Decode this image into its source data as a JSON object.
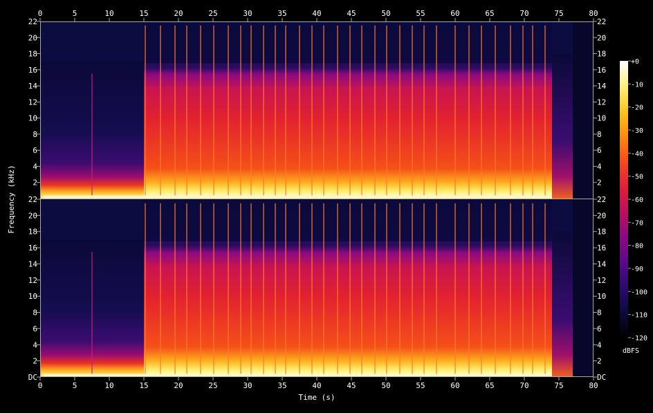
{
  "chart_data": {
    "type": "heatmap",
    "title": "",
    "xlabel": "Time (s)",
    "ylabel": "Frequency (kHz)",
    "xlim": [
      0,
      80
    ],
    "ylim_khz": [
      0,
      22
    ],
    "x_ticks": [
      0,
      5,
      10,
      15,
      20,
      25,
      30,
      35,
      40,
      45,
      50,
      55,
      60,
      65,
      70,
      75,
      80
    ],
    "x_tick_labels": [
      "0",
      "5",
      "10",
      "15",
      "20",
      "25",
      "30",
      "35",
      "40",
      "45",
      "50",
      "55",
      "60",
      "65",
      "70",
      "75",
      "80"
    ],
    "y_ticks": [
      0,
      2,
      4,
      6,
      8,
      10,
      12,
      14,
      16,
      18,
      20,
      22
    ],
    "y_tick_labels": [
      "DC",
      "2",
      "4",
      "6",
      "8",
      "10",
      "12",
      "14",
      "16",
      "18",
      "20",
      "22"
    ],
    "channels": 2,
    "colorbar": {
      "label": "dBFS",
      "range": [
        -120,
        0
      ],
      "ticks": [
        0,
        -10,
        -20,
        -30,
        -40,
        -50,
        -60,
        -70,
        -80,
        -90,
        -100,
        -110,
        -120
      ],
      "tick_labels": [
        "+0",
        "-10",
        "-20",
        "-30",
        "-40",
        "-50",
        "-60",
        "-70",
        "-80",
        "-90",
        "-100",
        "-110",
        "-120"
      ],
      "colors": [
        "#000000",
        "#0b0b3d",
        "#2a0b6e",
        "#5a0a8a",
        "#8a0a80",
        "#bb1060",
        "#e0203a",
        "#f54a20",
        "#fb8a10",
        "#fdc520",
        "#fff080",
        "#ffffff"
      ]
    },
    "segments": [
      {
        "start": 0,
        "end": 15,
        "level": "quiet intro, energy mostly below 4 kHz"
      },
      {
        "start": 15,
        "end": 74,
        "level": "loud, energy up to ~16.5 kHz"
      },
      {
        "start": 74,
        "end": 77,
        "level": "fade-out"
      }
    ],
    "transients_s": [
      7.5,
      15.2,
      17.4,
      19.5,
      21.2,
      23.2,
      25.1,
      27.2,
      29.0,
      30.5,
      32.3,
      34.0,
      35.5,
      37.5,
      39.3,
      41.0,
      43.0,
      44.8,
      46.5,
      48.4,
      50.1,
      52.0,
      53.8,
      55.5,
      57.3,
      60.0,
      62.0,
      63.8,
      65.8,
      68.0,
      69.8,
      71.2,
      73.0
    ],
    "signal_end_s": 77
  }
}
